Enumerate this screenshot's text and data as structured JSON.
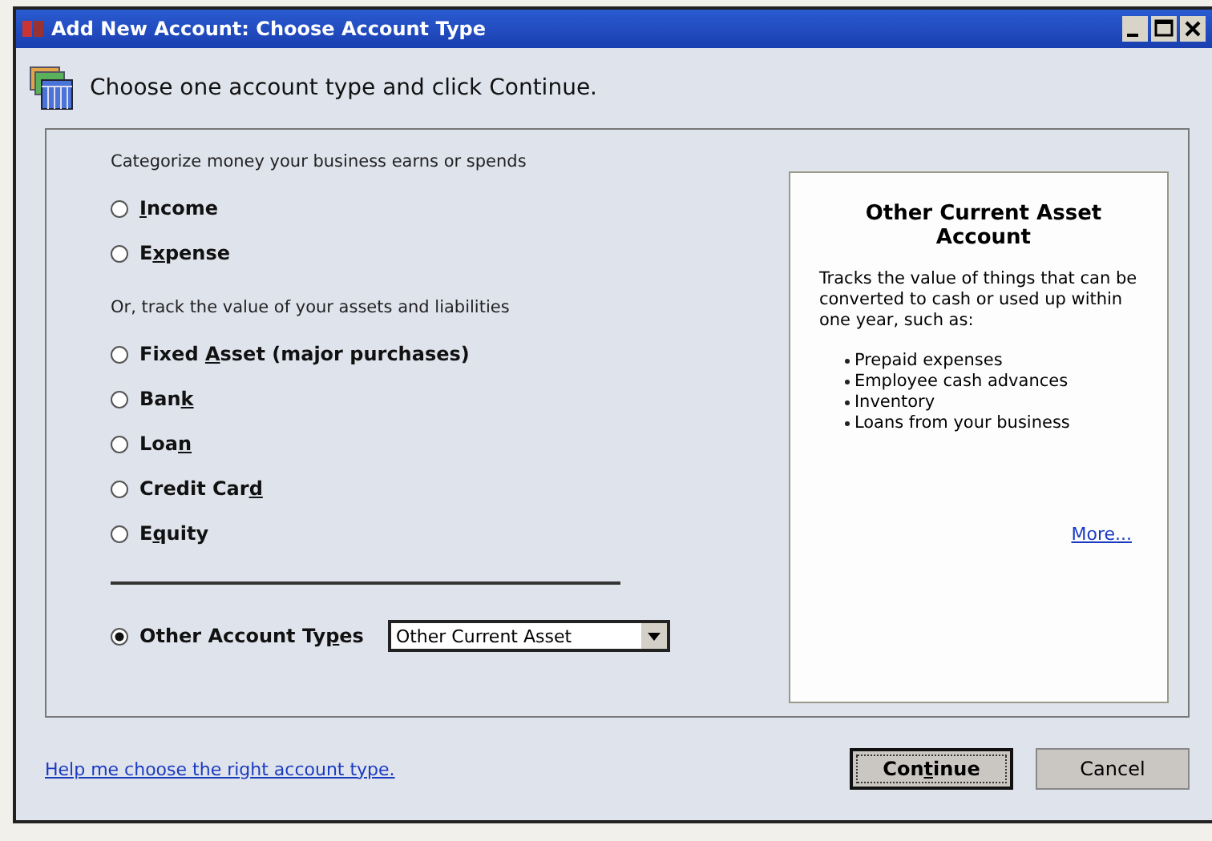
{
  "window": {
    "title": "Add New Account: Choose Account Type"
  },
  "instruction": "Choose one account type and click Continue.",
  "groups": [
    {
      "heading": "Categorize money your business earns or spends",
      "options": [
        {
          "key": "I",
          "after": "ncome",
          "selected": false
        },
        {
          "before": "E",
          "key": "x",
          "after": "pense",
          "selected": false
        }
      ]
    },
    {
      "heading": "Or, track the value of your assets and liabilities",
      "options": [
        {
          "before": "Fixed ",
          "key": "A",
          "after": "sset (major purchases)",
          "selected": false
        },
        {
          "before": "Ban",
          "key": "k",
          "selected": false
        },
        {
          "before": "Loa",
          "key": "n",
          "selected": false
        },
        {
          "before": "Credit Car",
          "key": "d",
          "selected": false
        },
        {
          "before": "E",
          "key": "q",
          "after": "uity",
          "selected": false
        }
      ]
    }
  ],
  "other": {
    "before": "Other Account Ty",
    "key": "p",
    "after": "es",
    "selected": true,
    "dropdown_value": "Other Current Asset"
  },
  "info": {
    "title": "Other Current Asset Account",
    "description": "Tracks the value of things that can be converted to cash or used up within one year, such as:",
    "bullets": [
      "Prepaid expenses",
      "Employee cash advances",
      "Inventory",
      "Loans from your business"
    ],
    "more_link": "More..."
  },
  "help_link": "Help me choose the right account type.",
  "buttons": [
    {
      "before": "Con",
      "key": "t",
      "after": "inue",
      "kind": "default"
    },
    {
      "before": "Cancel",
      "kind": "normal"
    }
  ]
}
